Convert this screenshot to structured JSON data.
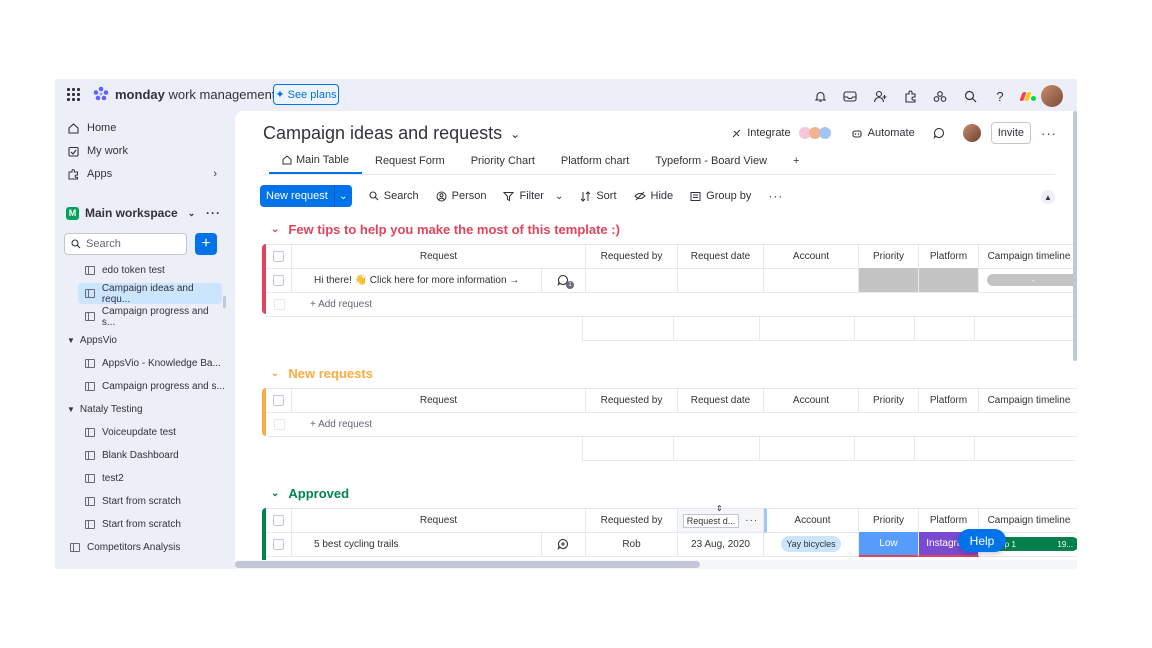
{
  "brand": {
    "name_bold": "monday",
    "name_rest": "work management"
  },
  "see_plans": "See plans",
  "sidebar": {
    "nav": [
      {
        "label": "Home",
        "icon": "home-icon"
      },
      {
        "label": "My work",
        "icon": "calendar-check-icon"
      },
      {
        "label": "Apps",
        "icon": "puzzle-icon"
      }
    ],
    "workspace": "Main workspace",
    "search_placeholder": "Search",
    "items": [
      {
        "label": "edo token test"
      },
      {
        "label": "Campaign ideas and requ...",
        "selected": true
      },
      {
        "label": "Campaign progress and s..."
      }
    ],
    "folder_appsvio": "AppsVio",
    "appsvio_items": [
      "AppsVio - Knowledge Ba...",
      "Campaign progress and s..."
    ],
    "folder_nataly": "Nataly Testing",
    "nataly_items": [
      "Voiceupdate test",
      "Blank Dashboard",
      "test2",
      "Start from scratch",
      "Start from scratch"
    ],
    "bottom_item": "Competitors Analysis"
  },
  "board": {
    "title": "Campaign ideas and requests",
    "integrate": "Integrate",
    "automate": "Automate",
    "invite": "Invite",
    "tabs": [
      "Main Table",
      "Request Form",
      "Priority Chart",
      "Platform chart",
      "Typeform - Board View",
      "+"
    ],
    "toolbar": {
      "new_button": "New request",
      "search": "Search",
      "person": "Person",
      "filter": "Filter",
      "sort": "Sort",
      "hide": "Hide",
      "group_by": "Group by"
    }
  },
  "columns": [
    "Request",
    "Requested by",
    "Request date",
    "Account",
    "Priority",
    "Platform",
    "Campaign timeline"
  ],
  "groups": [
    {
      "title": "Few tips to help you make the most of this template :)",
      "color": "#e2445c",
      "rows": [
        {
          "request": "Hi there! 👋 Click here for more information →",
          "updates": "1"
        }
      ],
      "add_label": "+ Add request"
    },
    {
      "title": "New requests",
      "color": "#fdab3d",
      "rows": [],
      "add_label": "+ Add request"
    },
    {
      "title": "Approved",
      "color": "#00854d",
      "header_request_date": "Request d...",
      "rows": [
        {
          "request": "5 best cycling trails",
          "requested_by": "Rob",
          "request_date": "23 Aug, 2020",
          "account": "Yay bicycles",
          "priority": "Low",
          "platform": "Instagram",
          "timeline_start": "Sep 1",
          "timeline_end": "19..."
        }
      ]
    }
  ],
  "colors": {
    "priority_low": "#579bfc",
    "platform_instagram": "#784bd1",
    "timeline": "#037f4c",
    "accent": "#0073ea"
  },
  "help": "Help"
}
